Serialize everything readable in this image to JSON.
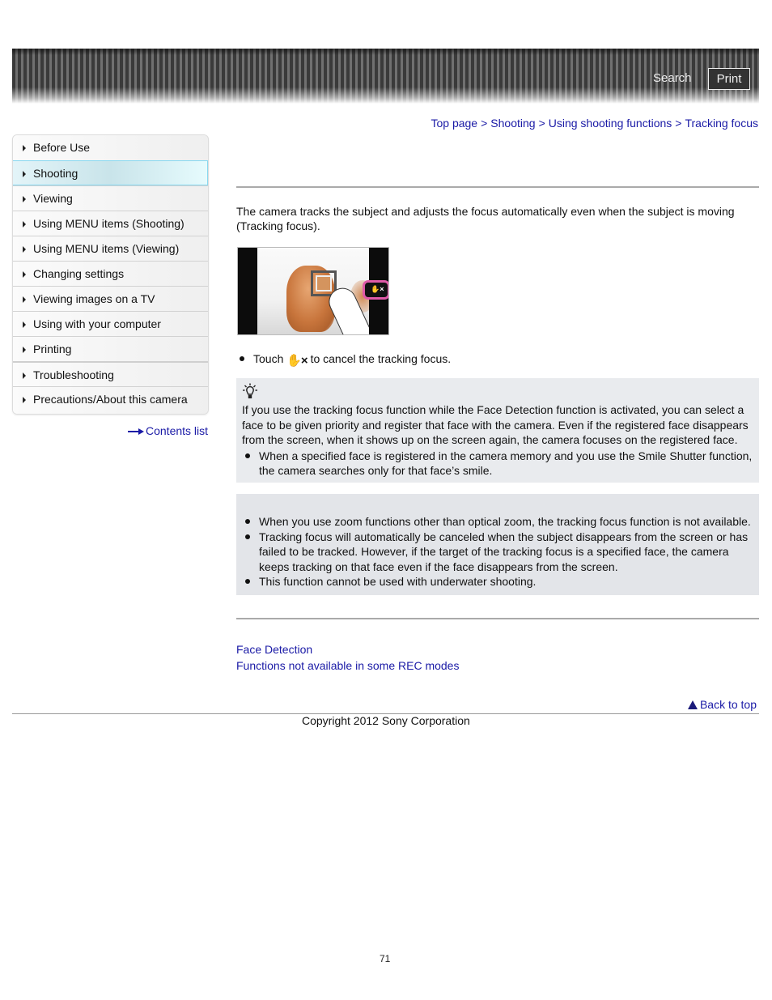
{
  "header": {
    "search_label": "Search",
    "print_label": "Print"
  },
  "breadcrumb": {
    "items": [
      "Top page",
      "Shooting",
      "Using shooting functions",
      "Tracking focus"
    ],
    "separator": ">"
  },
  "sidebar": {
    "items": [
      {
        "label": "Before Use"
      },
      {
        "label": "Shooting",
        "active": true
      },
      {
        "label": "Viewing"
      },
      {
        "label": "Using MENU items (Shooting)"
      },
      {
        "label": "Using MENU items (Viewing)"
      },
      {
        "label": "Changing settings"
      },
      {
        "label": "Viewing images on a TV"
      },
      {
        "label": "Using with your computer"
      },
      {
        "label": "Printing"
      },
      {
        "label": "Troubleshooting"
      },
      {
        "label": "Precautions/About this camera"
      }
    ],
    "contents_link": "Contents list",
    "accent_color": "#88d8f0"
  },
  "main": {
    "intro": "The camera tracks the subject and adjusts the focus automatically even when the subject is moving (Tracking focus).",
    "illustration": {
      "alt": "Touching the cat's face on screen to set tracking focus; cancel icon highlighted in pink",
      "cancel_icon_text": "✋×",
      "highlight_color": "#e05aa8"
    },
    "touch_line": {
      "before": "Touch",
      "icon": "✋×",
      "after": "to cancel the tracking focus."
    },
    "tip": {
      "icon": "lightbulb-icon",
      "text": "If you use the tracking focus function while the Face Detection function is activated, you can select a face to be given priority and register that face with the camera. Even if the registered face disappears from the screen, when it shows up on the screen again, the camera focuses on the registered face.",
      "bullets": [
        "When a specified face is registered in the camera memory and you use the Smile Shutter function, the camera searches only for that face’s smile."
      ]
    },
    "notes": {
      "bullets": [
        "When you use zoom functions other than optical zoom, the tracking focus function is not available.",
        "Tracking focus will automatically be canceled when the subject disappears from the screen or has failed to be tracked. However, if the target of the tracking focus is a specified face, the camera keeps tracking on that face even if the face disappears from the screen.",
        "This function cannot be used with underwater shooting."
      ]
    },
    "related_links": [
      "Face Detection",
      "Functions not available in some REC modes"
    ],
    "back_to_top": "Back to top"
  },
  "footer": {
    "copyright": "Copyright 2012 Sony Corporation",
    "page_number": "71"
  },
  "colors": {
    "link": "#1a1aa6",
    "tip_background": "#e9ebee",
    "note_background": "#e3e5e9"
  }
}
